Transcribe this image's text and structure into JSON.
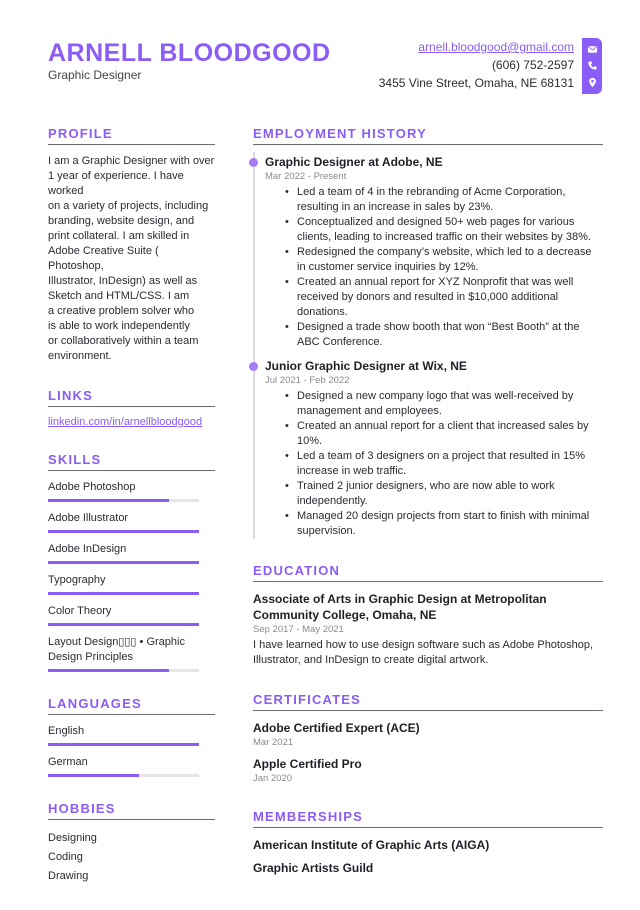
{
  "header": {
    "name": "ARNELL BLOODGOOD",
    "title": "Graphic Designer",
    "email": "arnell.bloodgood@gmail.com",
    "phone": "(606) 752-2597",
    "address": "3455 Vine Street, Omaha, NE 68131",
    "icons": [
      "envelope-icon",
      "phone-icon",
      "location-pin-icon"
    ]
  },
  "colors": {
    "accent": "#8b5cf6",
    "text": "#2b2b33",
    "muted": "#8a8a92",
    "bar_track": "#e6e6ea"
  },
  "profile": {
    "title": "PROFILE",
    "text": "I am a Graphic Designer with over\n1 year of experience. I have worked\non a variety of projects, including\nbranding, website design, and\nprint collateral. I am skilled in\nAdobe Creative Suite ( Photoshop,\nIllustrator, InDesign) as well as\nSketch and HTML/CSS. I am\na creative problem solver who\nis able to work independently\nor collaboratively within a team\nenvironment."
  },
  "links": {
    "title": "LINKS",
    "items": [
      {
        "label": "linkedin.com/in/arnellbloodgood"
      }
    ]
  },
  "skills": {
    "title": "SKILLS",
    "items": [
      {
        "label": "Adobe Photoshop",
        "level": 0.8
      },
      {
        "label": "Adobe Illustrator",
        "level": 1.0
      },
      {
        "label": "Adobe InDesign",
        "level": 1.0
      },
      {
        "label": "Typography",
        "level": 1.0
      },
      {
        "label": "Color Theory",
        "level": 1.0
      },
      {
        "label": "Layout Design▯▯▯ • Graphic Design Principles",
        "level": 0.8
      }
    ]
  },
  "languages": {
    "title": "LANGUAGES",
    "items": [
      {
        "label": "English",
        "level": 1.0
      },
      {
        "label": "German",
        "level": 0.6
      }
    ]
  },
  "hobbies": {
    "title": "HOBBIES",
    "items": [
      "Designing",
      "Coding",
      "Drawing"
    ]
  },
  "employment": {
    "title": "EMPLOYMENT HISTORY",
    "jobs": [
      {
        "title": "Graphic Designer at Adobe, NE",
        "date": "Mar 2022 - Present",
        "bullets": [
          "Led a team of 4 in the rebranding of Acme Corporation, resulting in an increase in sales by 23%.",
          "Conceptualized and designed 50+ web pages for various clients, leading to increased traffic on their websites by 38%.",
          "Redesigned the company’s website, which led to a decrease in customer service inquiries by 12%.",
          "Created an annual report for XYZ Nonprofit that was well received by donors and resulted in $10,000 additional donations.",
          "Designed a trade show booth that won “Best Booth” at the ABC Conference."
        ]
      },
      {
        "title": "Junior Graphic Designer at Wix, NE",
        "date": "Jul 2021 - Feb 2022",
        "bullets": [
          "Designed a new company logo that was well-received by management and employees.",
          "Created an annual report for a client that increased sales by 10%.",
          "Led a team of 3 designers on a project that resulted in 15% increase in web traffic.",
          "Trained 2 junior designers, who are now able to work independently.",
          "Managed 20 design projects from start to finish with minimal supervision."
        ]
      }
    ]
  },
  "education": {
    "title": "EDUCATION",
    "items": [
      {
        "title": "Associate of Arts in Graphic Design at Metropolitan Community College, Omaha, NE",
        "date": "Sep 2017 - May 2021",
        "text": "I have learned how to use design software such as Adobe Photoshop, Illustrator, and InDesign to create digital artwork."
      }
    ]
  },
  "certificates": {
    "title": "CERTIFICATES",
    "items": [
      {
        "title": "Adobe Certified Expert (ACE)",
        "date": "Mar 2021"
      },
      {
        "title": "Apple Certified Pro",
        "date": "Jan 2020"
      }
    ]
  },
  "memberships": {
    "title": "MEMBERSHIPS",
    "items": [
      "American Institute of Graphic Arts (AIGA)",
      "Graphic Artists Guild"
    ]
  }
}
